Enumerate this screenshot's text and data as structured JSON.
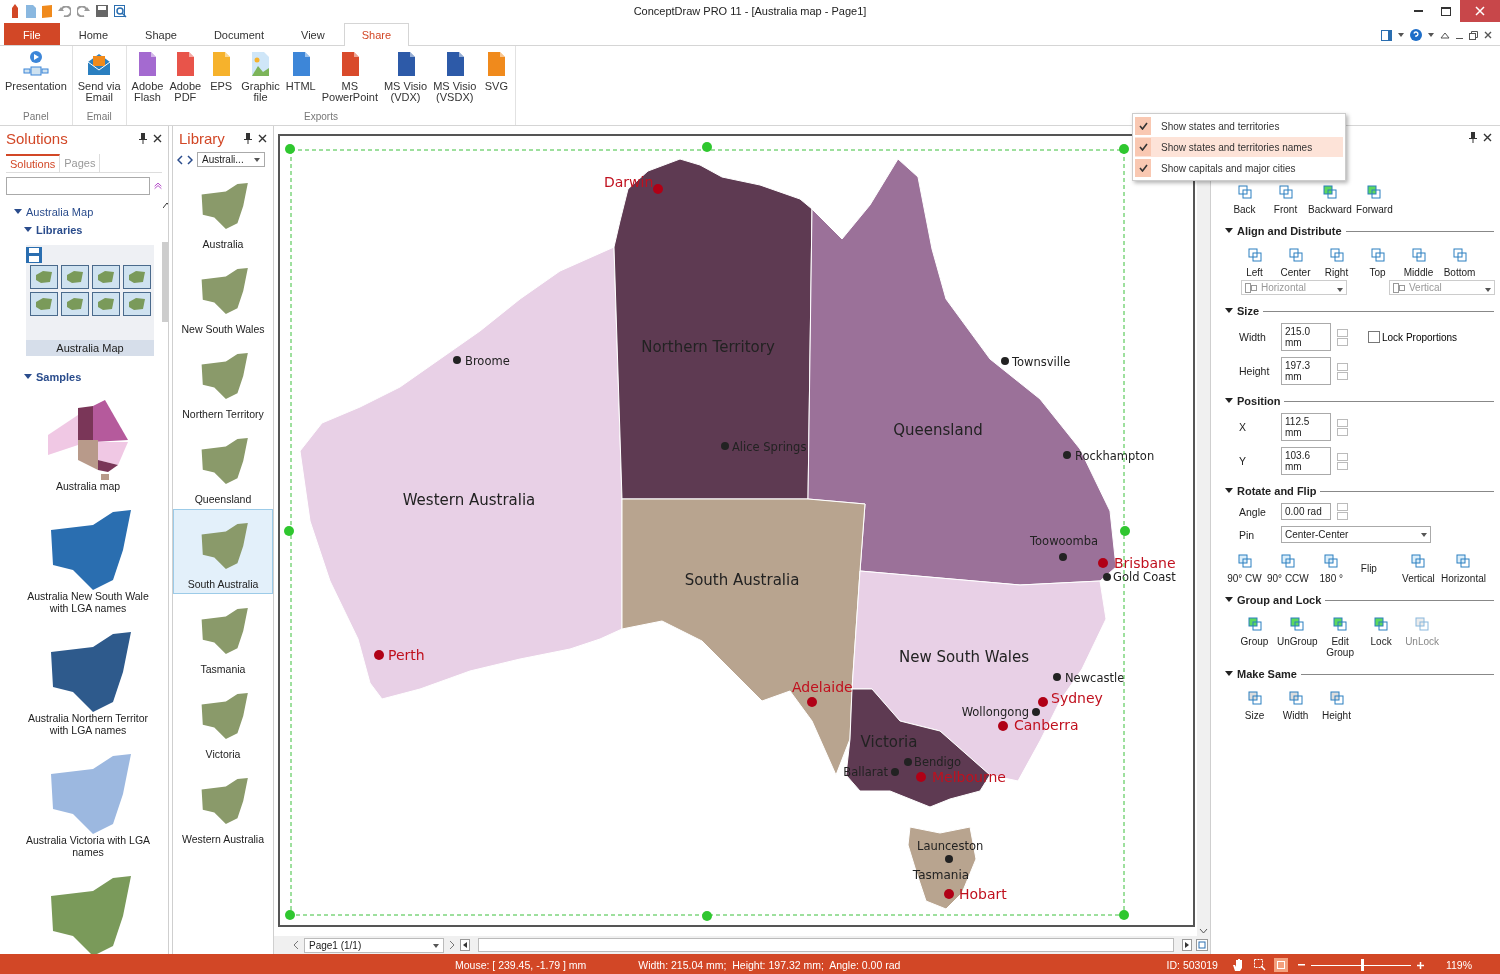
{
  "window": {
    "title": "ConceptDraw PRO 11 - [Australia map - Page1]"
  },
  "ribbon_tabs": [
    {
      "label": "File",
      "kind": "file",
      "selected": false
    },
    {
      "label": "Home",
      "kind": "tab",
      "selected": false
    },
    {
      "label": "Shape",
      "kind": "tab",
      "selected": false
    },
    {
      "label": "Document",
      "kind": "tab",
      "selected": false
    },
    {
      "label": "View",
      "kind": "tab",
      "selected": false
    },
    {
      "label": "Share",
      "kind": "tab",
      "selected": true
    }
  ],
  "ribbon_groups": [
    {
      "label": "Panel",
      "buttons": [
        {
          "label": "Presentation",
          "kind": "presentation"
        }
      ]
    },
    {
      "label": "Email",
      "buttons": [
        {
          "label": "Send via\nEmail",
          "kind": "email"
        }
      ]
    },
    {
      "label": "Exports",
      "buttons": [
        {
          "label": "Adobe\nFlash",
          "kind": "swf"
        },
        {
          "label": "Adobe\nPDF",
          "kind": "pdf"
        },
        {
          "label": "EPS",
          "kind": "eps"
        },
        {
          "label": "Graphic\nfile",
          "kind": "image"
        },
        {
          "label": "HTML",
          "kind": "html"
        },
        {
          "label": "MS\nPowerPoint",
          "kind": "ppt"
        },
        {
          "label": "MS Visio\n(VDX)",
          "kind": "visio"
        },
        {
          "label": "MS Visio\n(VSDX)",
          "kind": "visio"
        },
        {
          "label": "SVG",
          "kind": "svg"
        }
      ]
    }
  ],
  "solutions": {
    "title": "Solutions",
    "tabs": [
      {
        "label": "Solutions",
        "selected": true
      },
      {
        "label": "Pages",
        "selected": false
      }
    ],
    "tree": {
      "label": "Australia Map",
      "expanded": true,
      "libraries": {
        "label": "Libraries",
        "expanded": true,
        "library": "Australia Map"
      },
      "samples": {
        "label": "Samples",
        "expanded": true,
        "items": [
          {
            "label": "Australia map",
            "kind": "states"
          },
          {
            "label": "Australia New South Wale\nwith LGA names",
            "kind": "nsw"
          },
          {
            "label": "Australia Northern Territor\nwith LGA names",
            "kind": "nt"
          },
          {
            "label": "Australia Victoria with LGA\nnames",
            "kind": "vic"
          },
          {
            "kind": "cut"
          }
        ]
      }
    }
  },
  "library": {
    "title": "Library",
    "dropdown": "Australi...",
    "items": [
      {
        "label": "Australia",
        "selected": false
      },
      {
        "label": "New South Wales",
        "selected": false
      },
      {
        "label": "Northern Territory",
        "selected": false
      },
      {
        "label": "Queensland",
        "selected": false
      },
      {
        "label": "South Australia",
        "selected": true
      },
      {
        "label": "Tasmania",
        "selected": false
      },
      {
        "label": "Victoria",
        "selected": false
      },
      {
        "label": "Western Australia",
        "selected": false
      }
    ]
  },
  "map": {
    "states": [
      {
        "name": "Western Australia"
      },
      {
        "name": "Northern Territory"
      },
      {
        "name": "Queensland"
      },
      {
        "name": "South Australia"
      },
      {
        "name": "New South Wales"
      },
      {
        "name": "Victoria"
      },
      {
        "name": "Tasmania"
      }
    ],
    "cities": [
      {
        "name": "Darwin",
        "kind": "capital"
      },
      {
        "name": "Broome",
        "kind": "city"
      },
      {
        "name": "Alice Springs",
        "kind": "city"
      },
      {
        "name": "Townsville",
        "kind": "city"
      },
      {
        "name": "Rockhampton",
        "kind": "city"
      },
      {
        "name": "Toowoomba",
        "kind": "city"
      },
      {
        "name": "Brisbane",
        "kind": "capital"
      },
      {
        "name": "Gold Coast",
        "kind": "city"
      },
      {
        "name": "Perth",
        "kind": "capital"
      },
      {
        "name": "Adelaide",
        "kind": "capital"
      },
      {
        "name": "Newcastle",
        "kind": "city"
      },
      {
        "name": "Sydney",
        "kind": "capital"
      },
      {
        "name": "Wollongong",
        "kind": "city"
      },
      {
        "name": "Canberra",
        "kind": "capital"
      },
      {
        "name": "Bendigo",
        "kind": "city"
      },
      {
        "name": "Ballarat",
        "kind": "city"
      },
      {
        "name": "Melbourne",
        "kind": "capital"
      },
      {
        "name": "Launceston",
        "kind": "city"
      },
      {
        "name": "Hobart",
        "kind": "capital"
      }
    ]
  },
  "menu": {
    "items": [
      {
        "label": "Show states and territories",
        "checked": true,
        "selected": false
      },
      {
        "label": "Show states and territories names",
        "checked": true,
        "selected": true
      },
      {
        "label": "Show capitals and major cities",
        "checked": true,
        "selected": false
      }
    ]
  },
  "arrange": {
    "buttons": [
      "Back",
      "Front",
      "Backward",
      "Forward"
    ]
  },
  "align": {
    "title": "Align and Distribute",
    "expanded": true,
    "buttons": [
      "Left",
      "Center",
      "Right",
      "Top",
      "Middle",
      "Bottom"
    ],
    "dropdowns": [
      {
        "label": "Horizontal",
        "disabled": true
      },
      {
        "label": "Vertical",
        "disabled": true
      }
    ]
  },
  "size": {
    "title": "Size",
    "expanded": true,
    "fields": [
      {
        "label": "Width",
        "value": "215.0 mm"
      },
      {
        "label": "Height",
        "value": "197.3 mm"
      }
    ],
    "lock": {
      "label": "Lock Proportions",
      "checked": false
    }
  },
  "position": {
    "title": "Position",
    "expanded": true,
    "fields": [
      {
        "label": "X",
        "value": "112.5 mm"
      },
      {
        "label": "Y",
        "value": "103.6 mm"
      }
    ]
  },
  "rotate": {
    "title": "Rotate and Flip",
    "expanded": true,
    "angle": {
      "label": "Angle",
      "value": "0.00 rad"
    },
    "pin": {
      "label": "Pin",
      "value": "Center-Center"
    },
    "buttons": [
      "90° CW",
      "90° CCW",
      "180 °"
    ],
    "flip_label": "Flip",
    "flip_buttons": [
      "Vertical",
      "Horizontal"
    ]
  },
  "group_lock": {
    "title": "Group and Lock",
    "expanded": true,
    "buttons": [
      {
        "label": "Group",
        "disabled": false
      },
      {
        "label": "UnGroup",
        "disabled": false
      },
      {
        "label": "Edit\nGroup",
        "disabled": false
      },
      {
        "label": "Lock",
        "disabled": false
      },
      {
        "label": "UnLock",
        "disabled": true
      }
    ]
  },
  "make_same": {
    "title": "Make Same",
    "expanded": true,
    "buttons": [
      "Size",
      "Width",
      "Height"
    ]
  },
  "page_nav": {
    "page": "Page1 (1/1)"
  },
  "status_bar": {
    "mouse": "Mouse: [ 239.45, -1.79 ] mm",
    "dimensions": "Width: 215.04 mm;  Height: 197.32 mm;  Angle: 0.00 rad",
    "id": "ID: 503019",
    "zoom": "119%",
    "zoom_slider": {
      "level": 0.5
    }
  }
}
